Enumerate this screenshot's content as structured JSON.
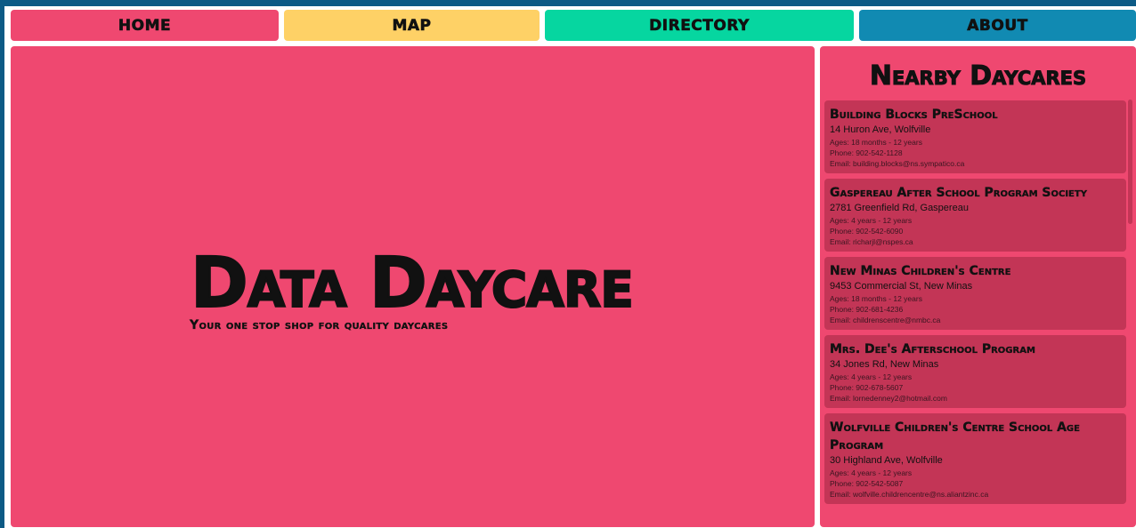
{
  "nav": {
    "home": "HOME",
    "map": "MAP",
    "directory": "DIRECTORY",
    "about": "ABOUT"
  },
  "hero": {
    "title": "Data Daycare",
    "subtitle": "Your one stop shop for quality daycares"
  },
  "sidebar": {
    "title": "Nearby Daycares",
    "daycares": [
      {
        "name": "Building Blocks PreSchool",
        "address": "14 Huron Ave, Wolfville",
        "ages": "Ages: 18 months - 12 years",
        "phone": "Phone: 902-542-1128",
        "email": "Email: building.blocks@ns.sympatico.ca"
      },
      {
        "name": "Gaspereau After School Program Society",
        "address": "2781 Greenfield Rd, Gaspereau",
        "ages": "Ages: 4 years - 12 years",
        "phone": "Phone: 902-542-6090",
        "email": "Email: richarjl@nspes.ca"
      },
      {
        "name": "New Minas Children's Centre",
        "address": "9453 Commercial St, New Minas",
        "ages": "Ages: 18 months - 12 years",
        "phone": "Phone: 902-681-4236",
        "email": "Email: childrenscentre@nmbc.ca"
      },
      {
        "name": "Mrs. Dee's Afterschool Program",
        "address": "34 Jones Rd, New Minas",
        "ages": "Ages: 4 years - 12 years",
        "phone": "Phone: 902-678-5607",
        "email": "Email: lornedenney2@hotmail.com"
      },
      {
        "name": "Wolfville Children's Centre School Age Program",
        "address": "30 Highland Ave, Wolfville",
        "ages": "Ages: 4 years - 12 years",
        "phone": "Phone: 902-542-5087",
        "email": "Email: wolfville.childrencentre@ns.aliantzinc.ca"
      }
    ]
  },
  "colors": {
    "frame": "#0c5a85",
    "home": "#ef4870",
    "map": "#fed166",
    "directory": "#06d6a0",
    "about": "#118ab2",
    "card": "#c33556"
  }
}
